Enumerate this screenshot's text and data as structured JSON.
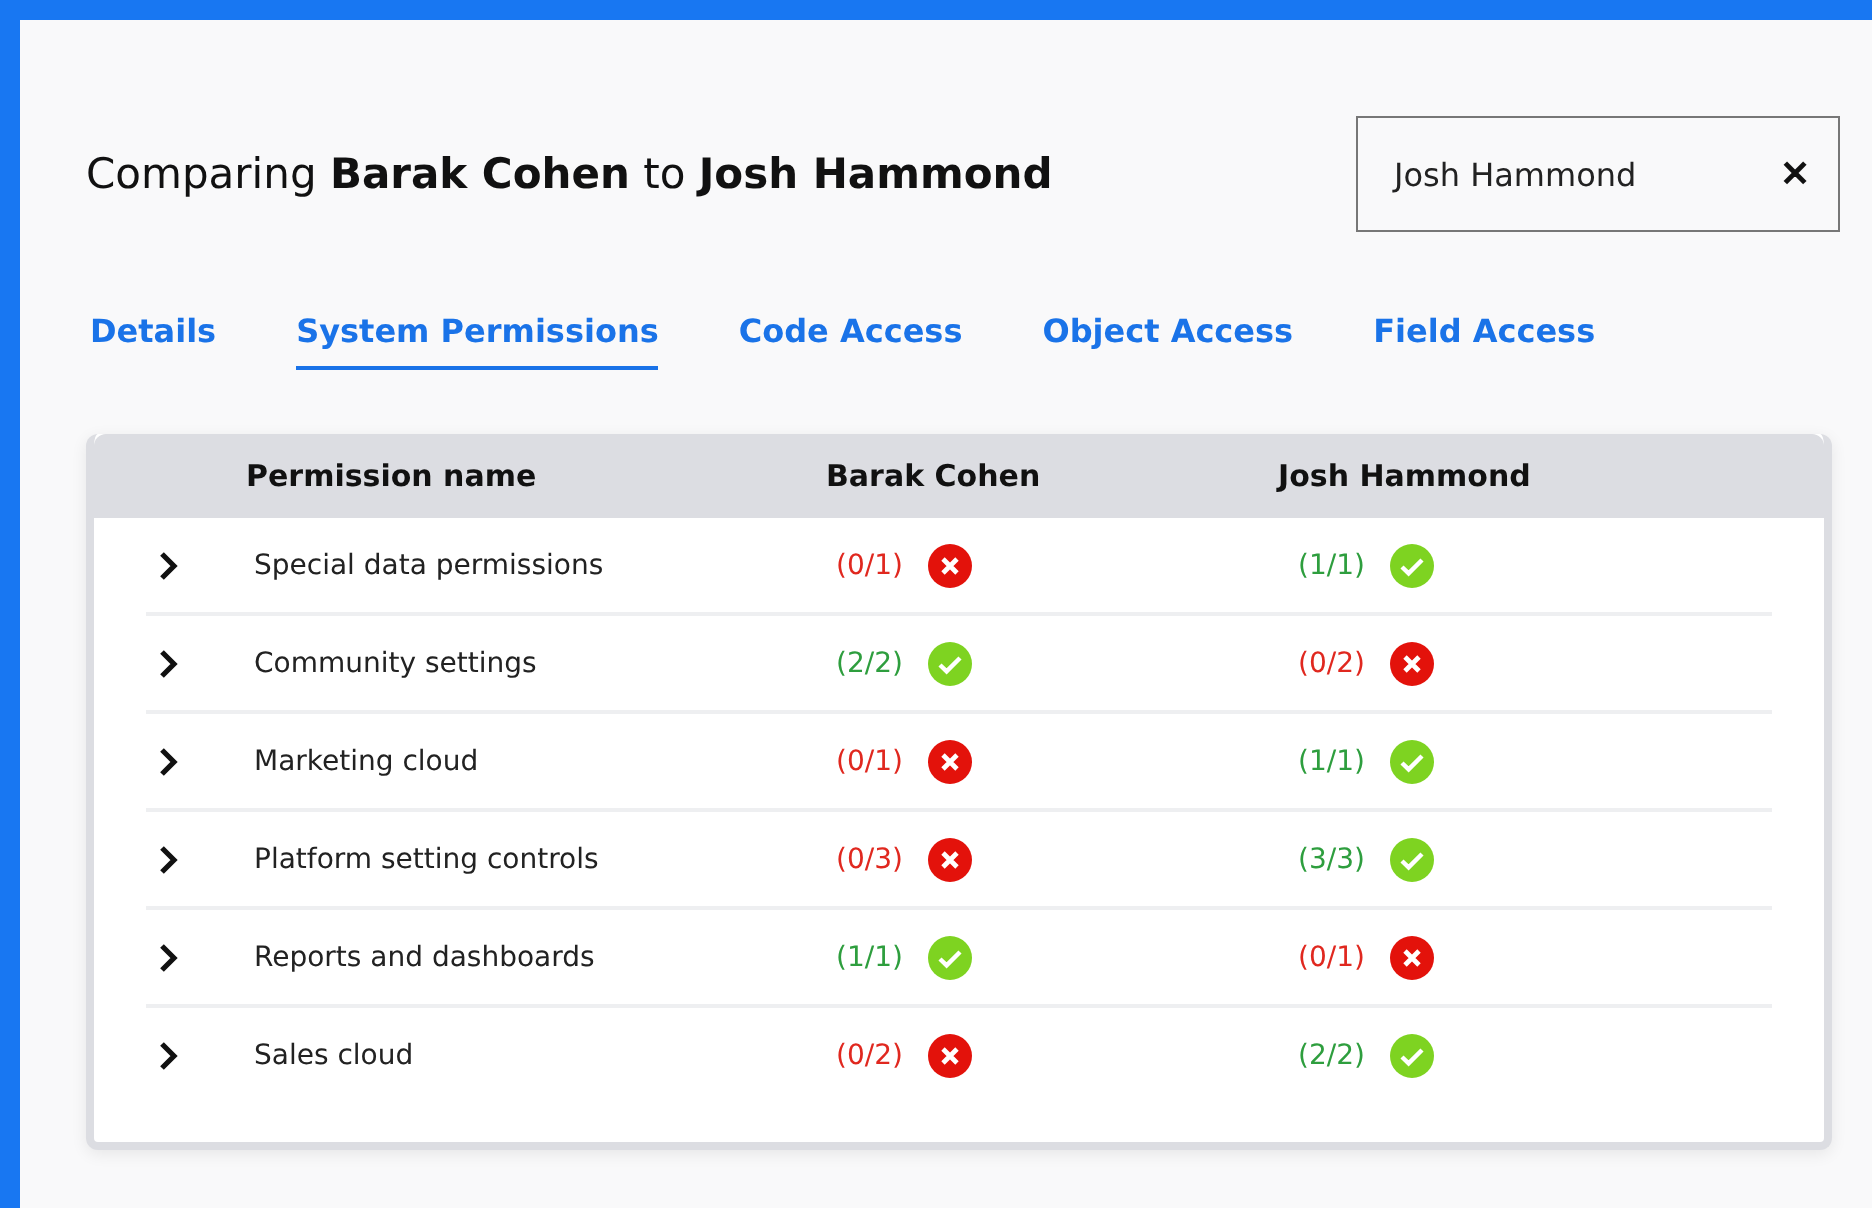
{
  "title": "Comparing **Barak Cohen** to **Josh Hammond**",
  "search": {
    "value": "Josh Hammond",
    "clear": "✕"
  },
  "tabs": [
    {
      "label": "Details",
      "selected": false
    },
    {
      "label": "System Permissions",
      "selected": true
    },
    {
      "label": "Code Access",
      "selected": false
    },
    {
      "label": "Object Access",
      "selected": false
    },
    {
      "label": "Field Access",
      "selected": false
    }
  ],
  "table": {
    "columns": [
      "Permission name",
      "Barak Cohen",
      "Josh Hammond"
    ],
    "rows": [
      {
        "cells": [
          {
            "text": "Special data permissions"
          },
          {
            "count": "(0/1)",
            "granted": false
          },
          {
            "count": "(1/1)",
            "granted": true
          }
        ]
      },
      {
        "cells": [
          {
            "text": "Community settings"
          },
          {
            "count": "(2/2)",
            "granted": true
          },
          {
            "count": "(0/2)",
            "granted": false
          }
        ]
      },
      {
        "cells": [
          {
            "text": "Marketing cloud"
          },
          {
            "count": "(0/1)",
            "granted": false
          },
          {
            "count": "(1/1)",
            "granted": true
          }
        ]
      },
      {
        "cells": [
          {
            "text": "Platform setting controls"
          },
          {
            "count": "(0/3)",
            "granted": false
          },
          {
            "count": "(3/3)",
            "granted": true
          }
        ]
      },
      {
        "cells": [
          {
            "text": "Reports and dashboards"
          },
          {
            "count": "(1/1)",
            "granted": true
          },
          {
            "count": "(0/1)",
            "granted": false
          }
        ]
      },
      {
        "cells": [
          {
            "text": "Sales cloud"
          },
          {
            "count": "(0/2)",
            "granted": false
          },
          {
            "count": "(2/2)",
            "granted": true
          }
        ]
      }
    ]
  }
}
